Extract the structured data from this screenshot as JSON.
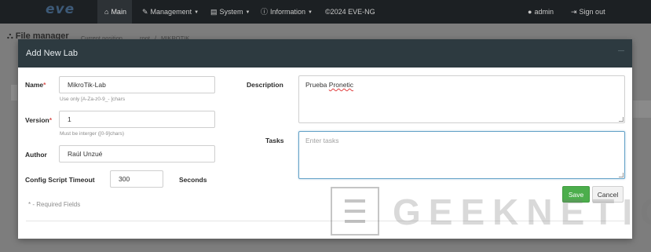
{
  "navbar": {
    "logo": "eve",
    "items": [
      {
        "label": "Main",
        "icon": "home-icon"
      },
      {
        "label": "Management",
        "icon": "wrench-icon"
      },
      {
        "label": "System",
        "icon": "hdd-icon"
      },
      {
        "label": "Information",
        "icon": "info-icon"
      },
      {
        "label": "©2024 EVE-NG"
      }
    ],
    "user": "admin",
    "signout": "Sign out"
  },
  "page": {
    "title": "File manager",
    "breadcrumb_label": "Current position",
    "breadcrumb_root": "root",
    "breadcrumb_sep": "/",
    "breadcrumb_folder": "MIKROTIK"
  },
  "modal": {
    "title": "Add New Lab",
    "name_label": "Name",
    "name_value": "MikroTik-Lab",
    "name_help": "Use only [A-Za-z0-9_- ]chars",
    "version_label": "Version",
    "version_value": "1",
    "version_help": "Must be interger ([0-9]chars)",
    "author_label": "Author",
    "author_value": "Raúl Unzué",
    "timeout_label": "Config Script Timeout",
    "timeout_value": "300",
    "timeout_unit": "Seconds",
    "description_label": "Description",
    "description_value_word1": "Prueba",
    "description_value_word2": "Pronetic",
    "tasks_label": "Tasks",
    "tasks_placeholder": "Enter tasks",
    "required_asterisk": "*",
    "required_note": "* - Required Fields",
    "save_label": "Save",
    "cancel_label": "Cancel"
  },
  "watermark": {
    "text": "GEEKNETIC"
  },
  "colors": {
    "navbar": "#1c2023",
    "modal_header": "#2d3a40",
    "save_button": "#4cae4c",
    "required": "#d9534f"
  }
}
